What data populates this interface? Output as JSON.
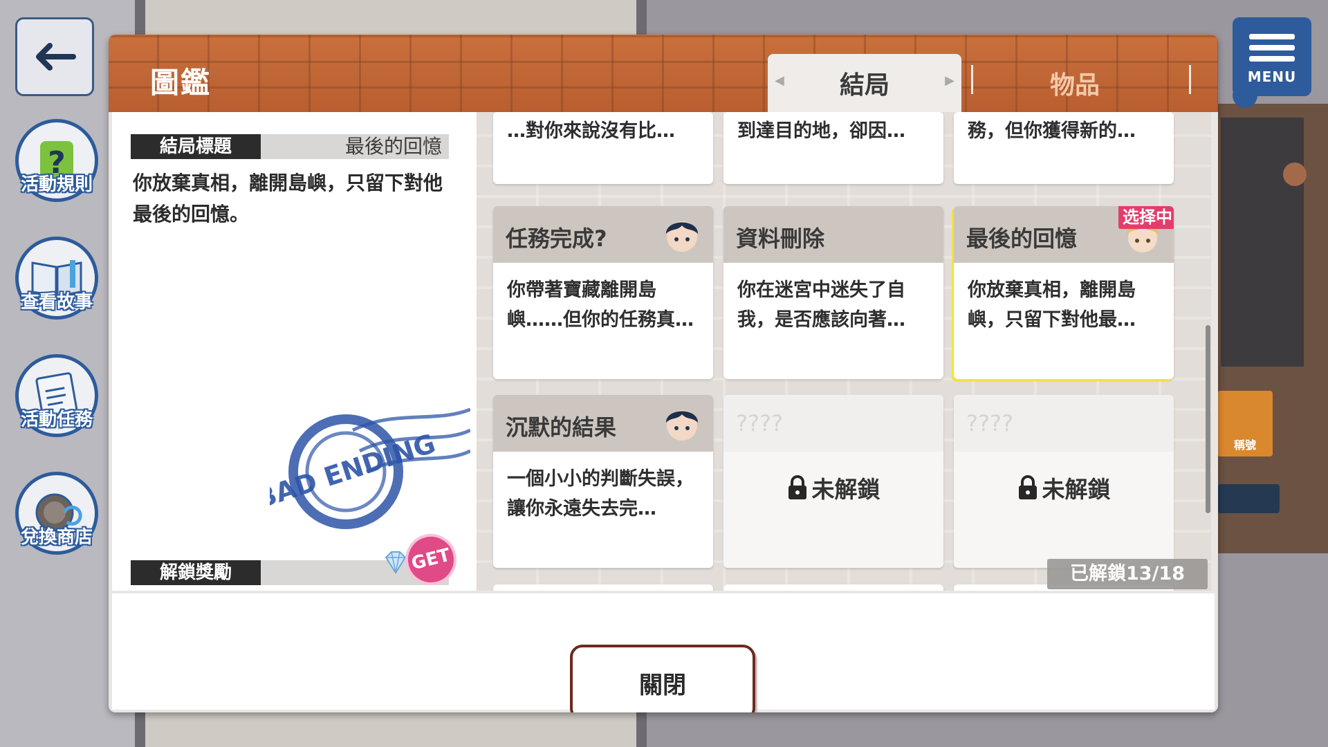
{
  "dialog": {
    "title": "圖鑑",
    "tabs": [
      {
        "label": "結局",
        "active": true
      },
      {
        "label": "物品",
        "active": false
      }
    ],
    "close_label": "關閉"
  },
  "detail": {
    "ending_title_label": "結局標題",
    "ending_title_value": "最後的回憶",
    "description": "你放棄真相，離開島嶼，只留下對他最後的回憶。",
    "stamp_text": "BAD ENDING",
    "reward_label": "解鎖獎勵",
    "reward_badge": "GET"
  },
  "endings": [
    {
      "body": "…對你來說沒有比…",
      "partial": true
    },
    {
      "body": "到達目的地，卻因…",
      "partial": true
    },
    {
      "body": "務，但你獲得新的…",
      "partial": true
    },
    {
      "title": "任務完成?",
      "body": "你帶著寶藏離開島嶼……但你的任務真…",
      "avatar": "dark-haired-boy"
    },
    {
      "title": "資料刪除",
      "body": "你在迷宮中迷失了自我，是否應該向著…"
    },
    {
      "title": "最後的回憶",
      "body": "你放棄真相，離開島嶼，只留下對他最…",
      "avatar": "blond-boy",
      "selected": true,
      "selected_badge": "选择中"
    },
    {
      "title": "沉默的結果",
      "body": "一個小小的判斷失誤，讓你永遠失去完…",
      "avatar": "dark-haired-boy"
    },
    {
      "title": "????",
      "locked_label": "未解鎖",
      "locked": true
    },
    {
      "title": "????",
      "locked_label": "未解鎖",
      "locked": true
    }
  ],
  "unlock_count": "已解鎖13/18",
  "hud": {
    "menu_label": "MENU",
    "side_buttons": [
      {
        "label": "活動規則",
        "icon": "question-icon"
      },
      {
        "label": "查看故事",
        "icon": "book-icon"
      },
      {
        "label": "活動任務",
        "icon": "notepad-icon"
      },
      {
        "label": "兌換商店",
        "icon": "exchange-icon"
      }
    ],
    "background_note_label": "稱號"
  },
  "colors": {
    "header_brick": "#c9703d",
    "accent_blue": "#2d5b9c",
    "selected_badge": "#e23d6d",
    "selected_outline": "#f5e23a",
    "close_border": "#6d2a1c"
  }
}
